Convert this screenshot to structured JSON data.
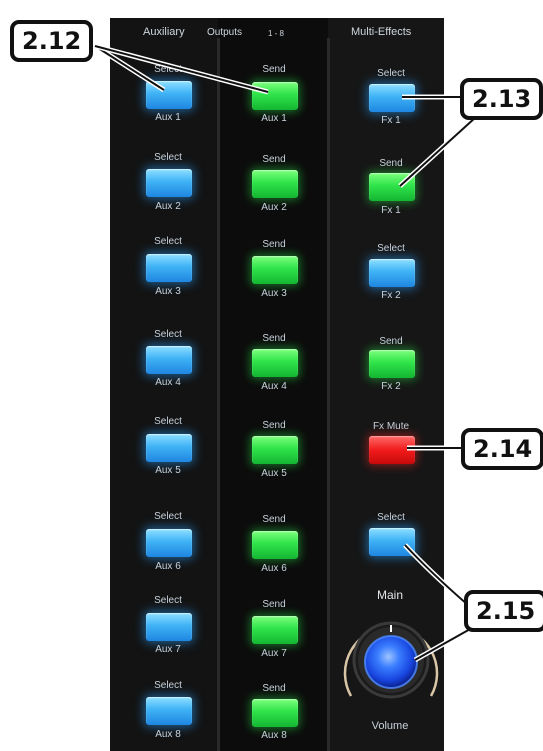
{
  "header": {
    "auxiliary": "Auxiliary",
    "outputs": "Outputs",
    "range": "1 - 8",
    "multi_effects": "Multi-Effects"
  },
  "aux_select": [
    {
      "top": "Select",
      "bottom": "Aux 1"
    },
    {
      "top": "Select",
      "bottom": "Aux 2"
    },
    {
      "top": "Select",
      "bottom": "Aux 3"
    },
    {
      "top": "Select",
      "bottom": "Aux 4"
    },
    {
      "top": "Select",
      "bottom": "Aux 5"
    },
    {
      "top": "Select",
      "bottom": "Aux 6"
    },
    {
      "top": "Select",
      "bottom": "Aux 7"
    },
    {
      "top": "Select",
      "bottom": "Aux 8"
    }
  ],
  "aux_send": [
    {
      "top": "Send",
      "bottom": "Aux 1"
    },
    {
      "top": "Send",
      "bottom": "Aux 2"
    },
    {
      "top": "Send",
      "bottom": "Aux 3"
    },
    {
      "top": "Send",
      "bottom": "Aux 4"
    },
    {
      "top": "Send",
      "bottom": "Aux 5"
    },
    {
      "top": "Send",
      "bottom": "Aux 6"
    },
    {
      "top": "Send",
      "bottom": "Aux 7"
    },
    {
      "top": "Send",
      "bottom": "Aux 8"
    }
  ],
  "fx": {
    "select1": {
      "top": "Select",
      "bottom": "Fx 1"
    },
    "send1": {
      "top": "Send",
      "bottom": "Fx 1"
    },
    "select2": {
      "top": "Select",
      "bottom": "Fx 2"
    },
    "send2": {
      "top": "Send",
      "bottom": "Fx 2"
    },
    "mute": {
      "top": "Fx Mute"
    }
  },
  "main": {
    "select": "Select",
    "title": "Main",
    "volume": "Volume"
  },
  "callouts": {
    "c212": "2.12",
    "c213": "2.13",
    "c214": "2.14",
    "c215": "2.15"
  },
  "colors": {
    "select_blue": "#3fb2f6",
    "send_green": "#2fe34a",
    "mute_red": "#f11b1b",
    "knob_blue": "#1b5cff"
  }
}
